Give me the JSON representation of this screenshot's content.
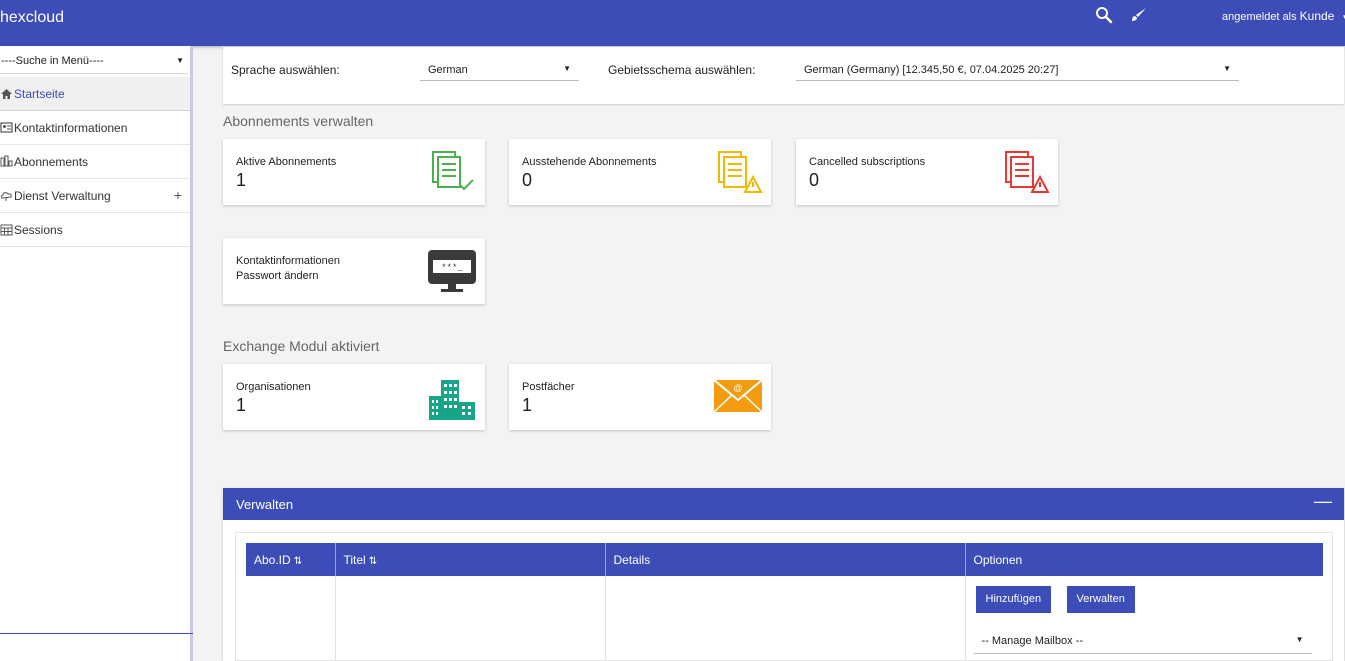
{
  "header": {
    "brand": "hexcloud",
    "user_prefix": "angemeldet als",
    "user_name": "Kunde",
    "icons": [
      "search-icon",
      "brush-icon"
    ]
  },
  "sidebar": {
    "search_placeholder": "----Suche in Menü----",
    "items": [
      {
        "label": "Startseite",
        "icon": "home-icon"
      },
      {
        "label": "Kontaktinformationen",
        "icon": "contact-card-icon"
      },
      {
        "label": "Abonnements",
        "icon": "subscriptions-icon"
      },
      {
        "label": "Dienst Verwaltung",
        "icon": "cloud-service-icon"
      },
      {
        "label": "Sessions",
        "icon": "calendar-icon"
      }
    ],
    "expand_symbol": "+"
  },
  "locale": {
    "language_label": "Sprache auswählen:",
    "language_value": "German",
    "region_label": "Gebietsschema auswählen:",
    "region_value": "German (Germany) [12.345,50 €, 07.04.2025 20:27]"
  },
  "subscriptions": {
    "title": "Abonnements verwalten",
    "cards": [
      {
        "label": "Aktive Abonnements",
        "value": "1",
        "color": "#4caf50"
      },
      {
        "label": "Ausstehende Abonnements",
        "value": "0",
        "color": "#f5b800"
      },
      {
        "label": "Cancelled subscriptions",
        "value": "0",
        "color": "#e53935"
      }
    ],
    "contact_card": {
      "line1": "Kontaktinformationen",
      "line2": "Passwort ändern",
      "icon_text": "***_"
    }
  },
  "exchange": {
    "title": "Exchange Modul aktiviert",
    "cards": [
      {
        "label": "Organisationen",
        "value": "1",
        "color": "#17a589"
      },
      {
        "label": "Postfächer",
        "value": "1",
        "color": "#f39c12"
      }
    ]
  },
  "manage": {
    "title": "Verwalten",
    "collapse": "—",
    "columns": [
      "Abo.ID",
      "Titel",
      "Details",
      "Optionen"
    ],
    "sort_symbol": "⇅",
    "add_button": "Hinzufügen",
    "manage_button": "Verwalten",
    "mailbox_select": "-- Manage Mailbox --"
  },
  "colors": {
    "primary": "#3d4db7"
  }
}
